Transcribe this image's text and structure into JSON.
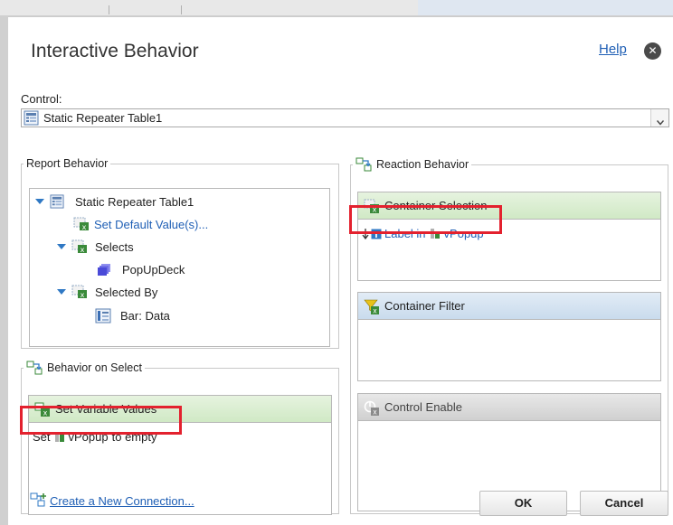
{
  "dialog": {
    "title": "Interactive Behavior",
    "help_label": "Help",
    "close_glyph": "✕"
  },
  "control": {
    "label": "Control:",
    "selected": "Static Repeater Table1"
  },
  "report_behavior": {
    "legend": "Report Behavior",
    "tree": {
      "root": "Static Repeater Table1",
      "set_default": "Set Default Value(s)...",
      "selects": "Selects",
      "selects_child": "PopUpDeck",
      "selected_by": "Selected By",
      "selected_by_child": "Bar: Data"
    }
  },
  "behavior_on_select": {
    "legend": "Behavior on Select",
    "panel_title": "Set Variable Values",
    "entry": {
      "prefix": "Set",
      "variable": "vPopup",
      "suffix": "to empty"
    }
  },
  "reaction_behavior": {
    "legend": "Reaction Behavior",
    "container_selection": {
      "title": "Container Selection",
      "entry": {
        "label": "Label in",
        "variable": "vPopup"
      }
    },
    "container_filter": {
      "title": "Container Filter"
    },
    "control_enable": {
      "title": "Control Enable"
    }
  },
  "footer": {
    "create_link": "Create a New Connection...",
    "ok_label": "OK",
    "cancel_label": "Cancel"
  },
  "colors": {
    "accent_link": "#1f5fb5",
    "highlight_red": "#e3212e",
    "green_header": "#d0e9c5",
    "blue_header": "#c9dbed",
    "gray_header": "#d0d0d0"
  }
}
